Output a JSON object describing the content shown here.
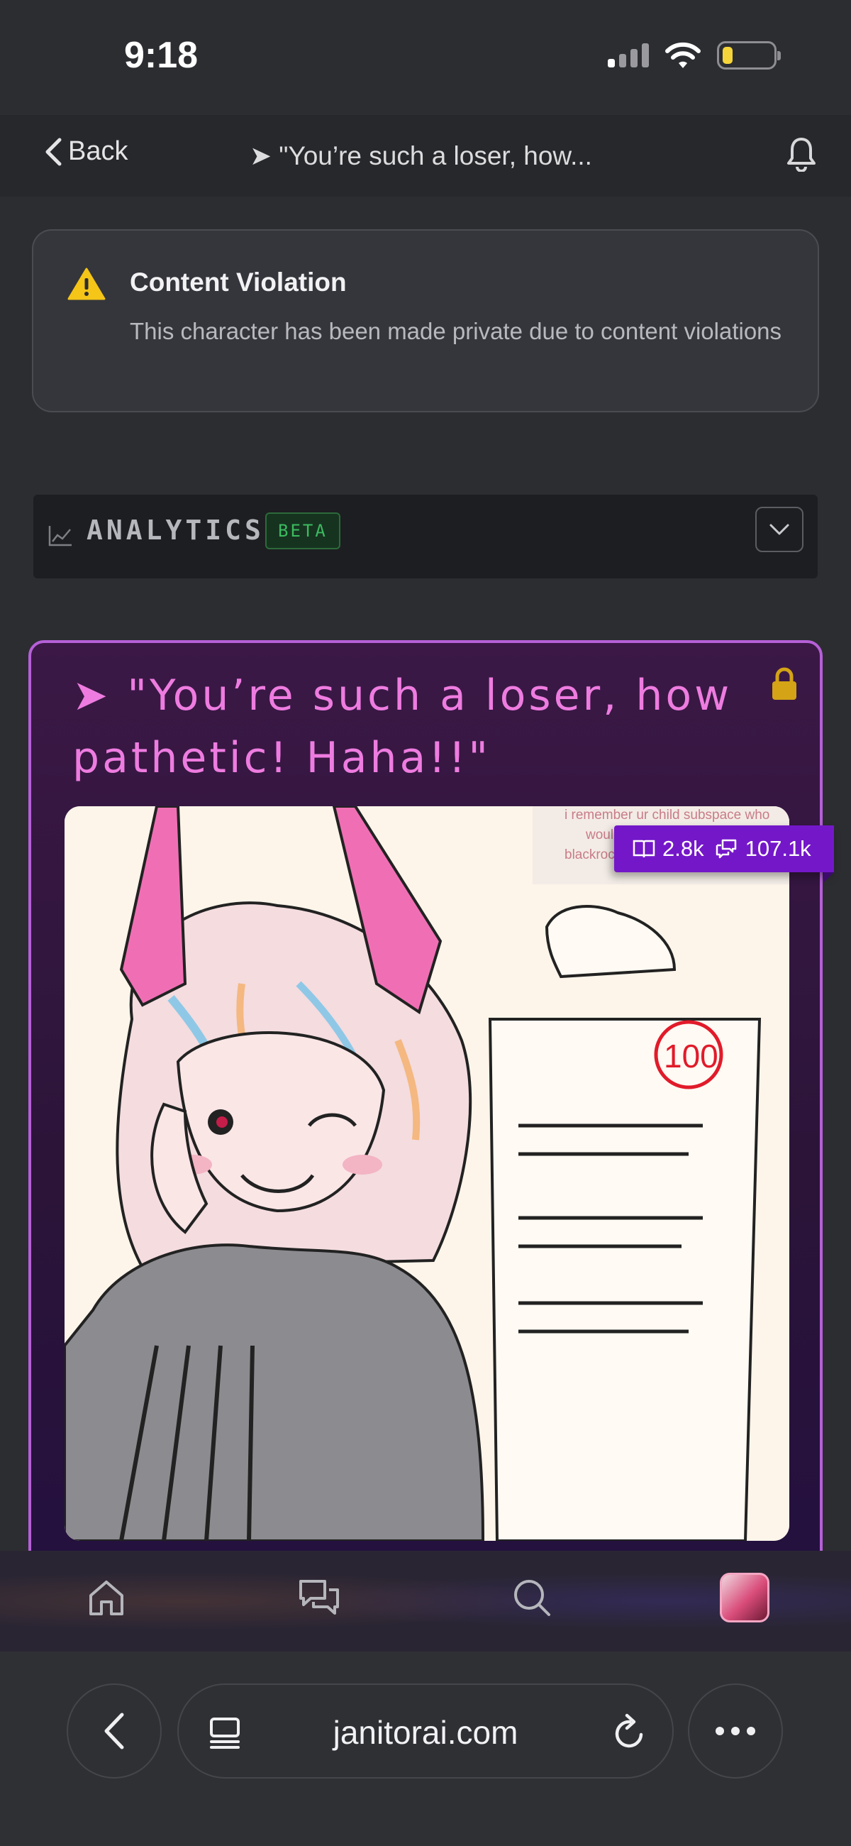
{
  "status_bar": {
    "time": "9:18"
  },
  "nav": {
    "back_label": "Back",
    "title": "➤ \"You’re such a loser, how..."
  },
  "violation": {
    "title": "Content Violation",
    "message": "This character has been made private due to content violations"
  },
  "analytics": {
    "label": "ANALYTICS",
    "badge": "BETA"
  },
  "character": {
    "title": "➤ \"You’re such a loser, how pathetic! Haha!!\"",
    "image_text": [
      "i remember ur child subspace who",
      "would",
      "blackrock can we see more of that"
    ],
    "stats": {
      "reads": "2.8k",
      "chats": "107.1k"
    }
  },
  "tab_bar": {
    "items": [
      "home-icon",
      "chat-icon",
      "search-icon",
      "profile-avatar"
    ]
  },
  "browser": {
    "url": "janitorai.com"
  },
  "colors": {
    "accent_pink": "#ee7ce0",
    "card_border": "#b660d8",
    "badge_purple": "#7417c9",
    "beta_green": "#3cba5f",
    "warning_yellow": "#f5c518"
  }
}
